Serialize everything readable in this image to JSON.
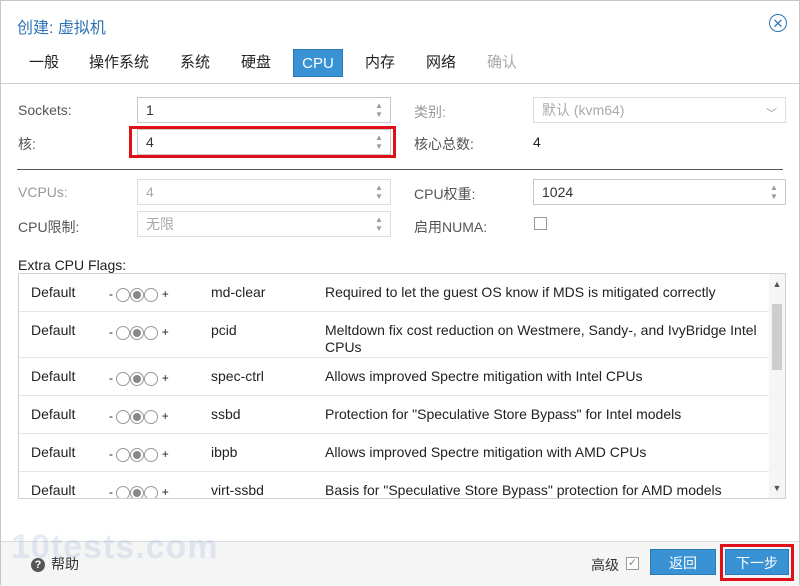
{
  "window": {
    "title": "创建: 虚拟机",
    "close_glyph": "⊗"
  },
  "tabs": [
    {
      "label": "一般",
      "state": "normal"
    },
    {
      "label": "操作系统",
      "state": "normal"
    },
    {
      "label": "系统",
      "state": "normal"
    },
    {
      "label": "硬盘",
      "state": "normal"
    },
    {
      "label": "CPU",
      "state": "active"
    },
    {
      "label": "内存",
      "state": "normal"
    },
    {
      "label": "网络",
      "state": "normal"
    },
    {
      "label": "确认",
      "state": "disabled"
    }
  ],
  "form": {
    "sockets_label": "Sockets:",
    "sockets_value": "1",
    "cores_label": "核:",
    "cores_value": "4",
    "type_label": "类别:",
    "type_value": "默认 (kvm64)",
    "total_cores_label": "核心总数:",
    "total_cores_value": "4",
    "vcpus_label": "VCPUs:",
    "vcpus_value": "4",
    "cpu_limit_label": "CPU限制:",
    "cpu_limit_value": "无限",
    "cpu_weight_label": "CPU权重:",
    "cpu_weight_value": "1024",
    "numa_label": "启用NUMA:"
  },
  "flags": {
    "label": "Extra CPU Flags:",
    "minus": "-",
    "plus": "+",
    "rows": [
      {
        "state": "Default",
        "name": "md-clear",
        "description": "Required to let the guest OS know if MDS is mitigated correctly"
      },
      {
        "state": "Default",
        "name": "pcid",
        "description": "Meltdown fix cost reduction on Westmere, Sandy-, and IvyBridge Intel CPUs"
      },
      {
        "state": "Default",
        "name": "spec-ctrl",
        "description": "Allows improved Spectre mitigation with Intel CPUs"
      },
      {
        "state": "Default",
        "name": "ssbd",
        "description": "Protection for \"Speculative Store Bypass\" for Intel models"
      },
      {
        "state": "Default",
        "name": "ibpb",
        "description": "Allows improved Spectre mitigation with AMD CPUs"
      },
      {
        "state": "Default",
        "name": "virt-ssbd",
        "description": "Basis for \"Speculative Store Bypass\" protection for AMD models"
      }
    ]
  },
  "footer": {
    "help_label": "帮助",
    "advanced_label": "高级",
    "back_label": "返回",
    "next_label": "下一步"
  },
  "watermark": "10tests.com",
  "colors": {
    "accent": "#3892d3",
    "highlight": "#e0101a"
  }
}
